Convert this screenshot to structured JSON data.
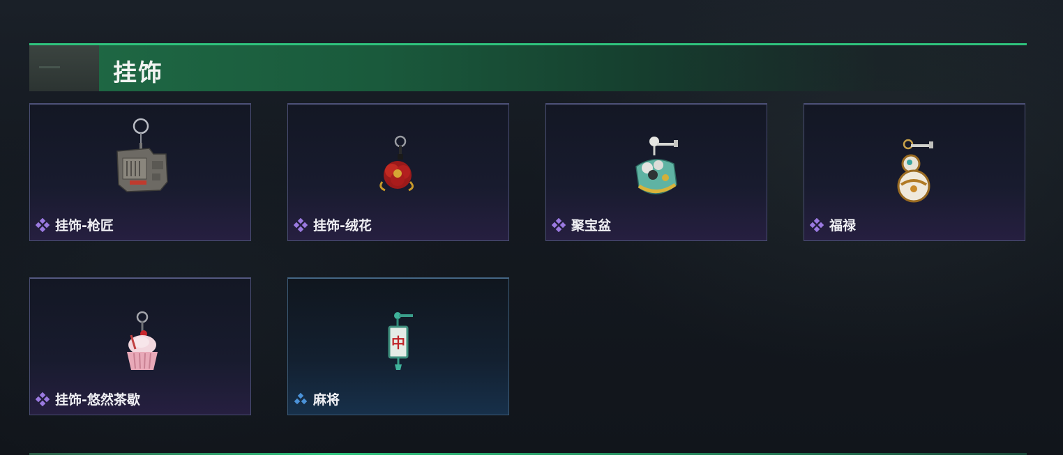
{
  "section": {
    "title": "挂饰"
  },
  "items": [
    {
      "name": "挂饰-枪匠",
      "rarity": "purple",
      "icon": "gunsmith-charm-icon"
    },
    {
      "name": "挂饰-绒花",
      "rarity": "purple",
      "icon": "velvet-flower-charm-icon"
    },
    {
      "name": "聚宝盆",
      "rarity": "purple",
      "icon": "treasure-bowl-charm-icon"
    },
    {
      "name": "福禄",
      "rarity": "purple",
      "icon": "gourd-charm-icon"
    },
    {
      "name": "挂饰-悠然茶歇",
      "rarity": "purple",
      "icon": "cupcake-charm-icon"
    },
    {
      "name": "麻将",
      "rarity": "blue",
      "icon": "mahjong-tile-charm-icon",
      "tile_char": "中"
    }
  ],
  "colors": {
    "accent": "#2fc37d",
    "rarity_purple": "#9b7ae0",
    "rarity_blue": "#4b92d8"
  }
}
